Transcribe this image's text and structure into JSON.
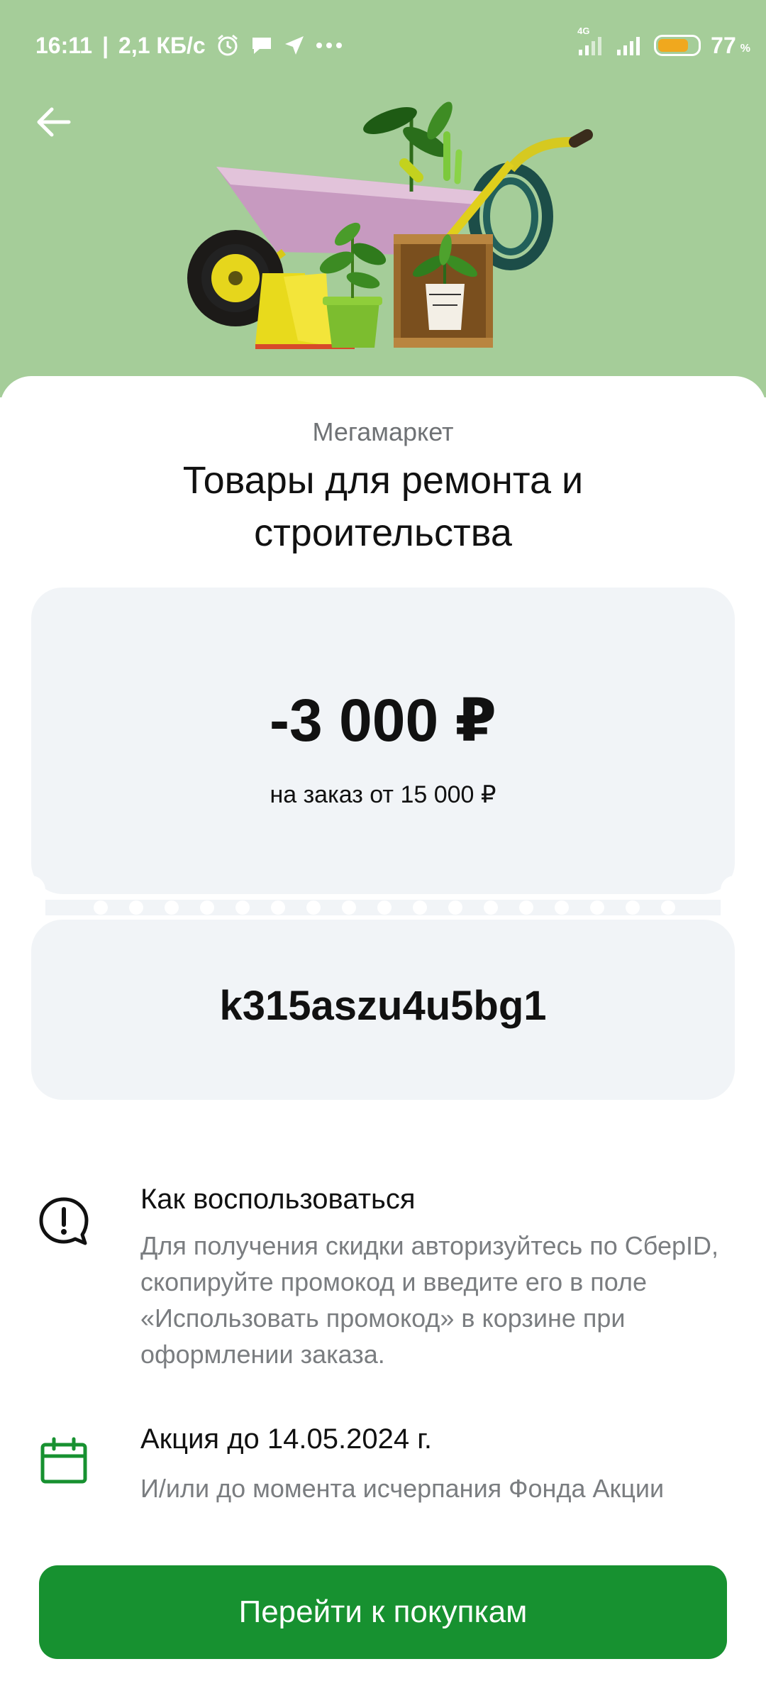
{
  "status_bar": {
    "time": "16:11",
    "speed": "2,1 КБ/с",
    "network": "4G",
    "battery_percent": "77",
    "percent_sign": "%",
    "battery_level": 0.77,
    "icons": [
      "alarm-icon",
      "chat-icon",
      "location-arrow-icon",
      "more-dots-icon",
      "signal-4g-icon",
      "signal-icon",
      "battery-icon"
    ]
  },
  "header": {
    "back_icon": "arrow-left-icon",
    "hero_color": "#a5cd99"
  },
  "offer": {
    "store": "Мегамаркет",
    "title": "Товары для ремонта и строительства",
    "discount": "-3 000 ₽",
    "condition": "на заказ от 15 000 ₽",
    "promo_code": "k315aszu4u5bg1"
  },
  "how_to_use": {
    "icon": "exclamation-bubble-icon",
    "title": "Как воспользоваться",
    "text": "Для получения скидки авторизуйтесь по СберID, скопируйте промокод и введите его в поле «Использовать промокод» в корзине при оформлении заказа."
  },
  "validity": {
    "icon": "calendar-icon",
    "title": "Акция до 14.05.2024 г.",
    "text": "И/или до момента исчерпания Фонда Акции"
  },
  "cta": {
    "label": "Перейти к покупкам",
    "color": "#179130"
  },
  "colors": {
    "accent_green": "#179130",
    "coupon_bg": "#f1f4f7",
    "battery": "#f0a81e"
  }
}
